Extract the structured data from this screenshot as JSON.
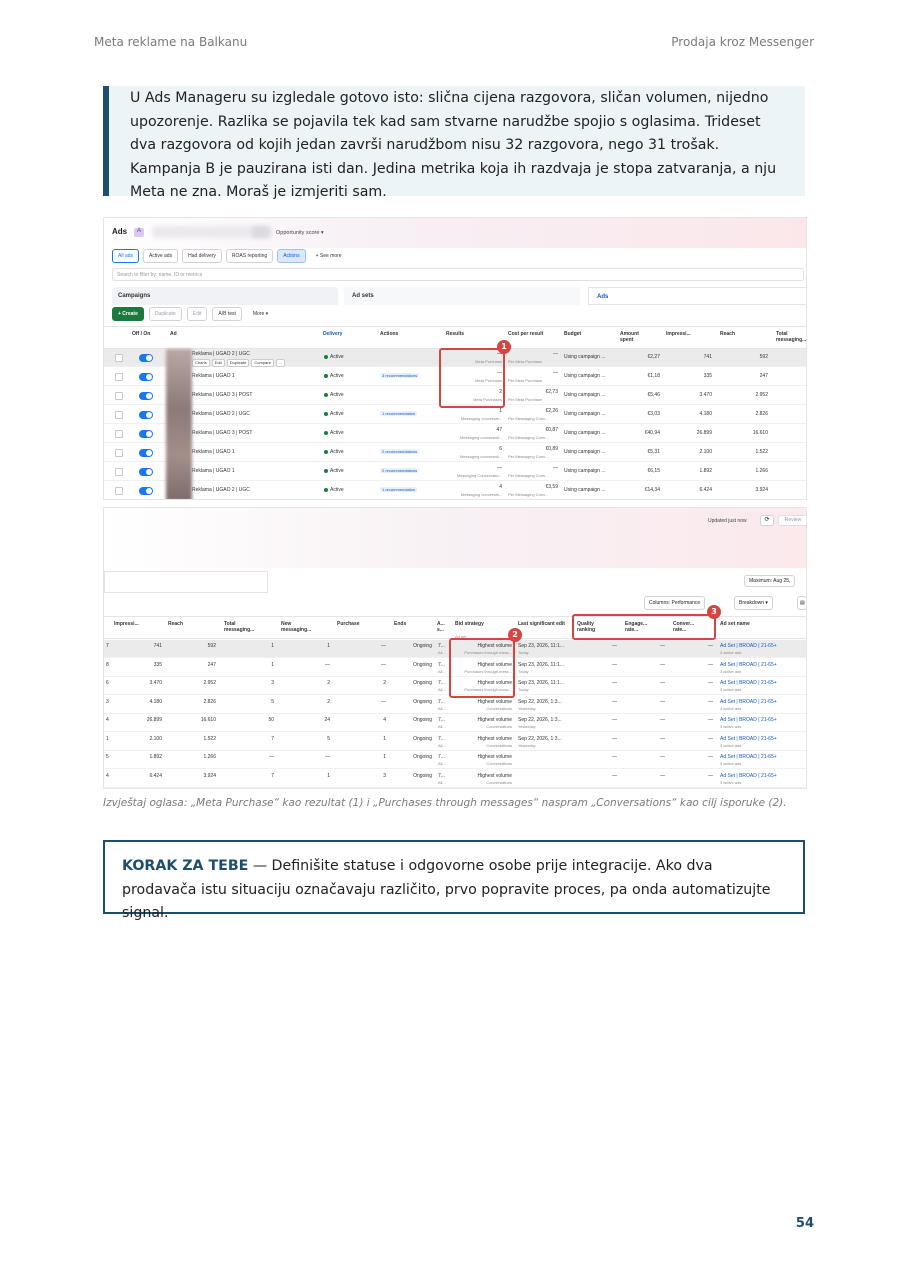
{
  "header": {
    "left": "Meta reklame na Balkanu",
    "right": "Prodaja kroz Messenger"
  },
  "quote": "U Ads Manageru su izgledale gotovo isto: slična cijena razgovora, sličan volumen, nijedno upozorenje. Razlika se pojavila tek kad sam stvarne narudžbe spojio s oglasima. Trideset dva razgovora od kojih jedan završi narudžbom nisu 32 razgovora, nego 31 trošak. Kampanja B je pauzirana isti dan. Jedina metrika koja ih razdvaja je stopa zatvaranja, a nju Meta ne zna. Moraš je izmjeriti sam.",
  "screenshot1": {
    "title": "Ads",
    "title_chip": "A",
    "opportunity": "Opportunity score ▾",
    "filters": [
      "All ads",
      "Active ads",
      "Had delivery",
      "ROAS reporting",
      "Actions",
      "+ See more"
    ],
    "search_placeholder": "Search to filter by: name, ID or metrics",
    "tabs": [
      "Campaigns",
      "Ad sets",
      "Ads"
    ],
    "actions": [
      "+ Create",
      "Duplicate",
      "Edit",
      "A/B test",
      "More ▾"
    ],
    "columns": [
      "Off / On",
      "Ad",
      "Delivery",
      "Actions",
      "Results",
      "Cost per result",
      "Budget",
      "Amount spent",
      "Impressi...",
      "Reach",
      "Total messaging..."
    ],
    "hover_actions": [
      "Charts",
      "Edit",
      "Duplicate",
      "Compare",
      "..."
    ],
    "rows": [
      {
        "name": "Reklama | UGAO 2 | UGC",
        "delivery": "Active",
        "actions": "",
        "result": "—",
        "result_sub": "Meta Purchase",
        "cpr": "—",
        "cpr_sub": "Per Meta Purchase",
        "budget": "Using campaign ...",
        "spent": "€2,27",
        "impr": "741",
        "reach": "592"
      },
      {
        "name": "Reklama | UGAO 1",
        "delivery": "Active",
        "actions": "3 recommendations",
        "result": "—",
        "result_sub": "Meta Purchase",
        "cpr": "—",
        "cpr_sub": "Per Meta Purchase",
        "budget": "Using campaign ...",
        "spent": "€1,18",
        "impr": "335",
        "reach": "247"
      },
      {
        "name": "Reklama | UGAO 3 | POST",
        "delivery": "Active",
        "actions": "",
        "result": "2",
        "result_sub": "Meta Purchases",
        "cpr": "€2,73",
        "cpr_sub": "Per Meta Purchase",
        "budget": "Using campaign ...",
        "spent": "€5,46",
        "impr": "3.470",
        "reach": "2.952"
      },
      {
        "name": "Reklama | UGAO 2 | UGC",
        "delivery": "Active",
        "actions": "1 recommendation",
        "result": "1",
        "result_sub": "Messaging conversat...",
        "cpr": "€2,26",
        "cpr_sub": "Per Messaging Conv...",
        "budget": "Using campaign ...",
        "spent": "€3,03",
        "impr": "4.180",
        "reach": "2.826"
      },
      {
        "name": "Reklama | UGAO 3 | POST",
        "delivery": "Active",
        "actions": "",
        "result": "47",
        "result_sub": "Messaging conversati...",
        "cpr": "€0,87",
        "cpr_sub": "Per Messaging Conv...",
        "budget": "Using campaign ...",
        "spent": "€40,94",
        "impr": "26.899",
        "reach": "16.610"
      },
      {
        "name": "Reklama | UGAO 1",
        "delivery": "Active",
        "actions": "2 recommendations",
        "result": "6",
        "result_sub": "Messaging conversati...",
        "cpr": "€0,89",
        "cpr_sub": "Per Messaging Conv...",
        "budget": "Using campaign ...",
        "spent": "€5,31",
        "impr": "2.100",
        "reach": "1.522"
      },
      {
        "name": "Reklama | UGAO 1",
        "delivery": "Active",
        "actions": "2 recommendations",
        "result": "—",
        "result_sub": "Messaging Conversatio...",
        "cpr": "—",
        "cpr_sub": "Per Messaging Conv...",
        "budget": "Using campaign ...",
        "spent": "€6,15",
        "impr": "1.892",
        "reach": "1.266"
      },
      {
        "name": "Reklama | UGAO 2 | UGC",
        "delivery": "Active",
        "actions": "1 recommendation",
        "result": "4",
        "result_sub": "Messaging conversat...",
        "cpr": "€3,59",
        "cpr_sub": "Per Messaging Conv...",
        "budget": "Using campaign ...",
        "spent": "€14,34",
        "impr": "6.424",
        "reach": "3.924"
      }
    ]
  },
  "screenshot2": {
    "updated": "Updated just now",
    "review": "Review",
    "max_chip": "Maximum: Aug 25,",
    "columns_chip": "Columns: Performance",
    "breakdown_chip": "Breakdown ▾",
    "columns": [
      "Impressi...",
      "Reach",
      "Total messaging...",
      "New messaging...",
      "Purchase",
      "Ends",
      "A... s...",
      "Bid strategy",
      "Last significant edit",
      "Quality ranking",
      "Engage... rate...",
      "Conver... rate...",
      "Ad set name"
    ],
    "col_subs": {
      "bid": "Ad set",
      "quality": "Ad relevance...",
      "engage": "Ad relevance...",
      "conver": "Ad relevance..."
    },
    "rows": [
      {
        "lead": "7",
        "impr": "741",
        "reach": "592",
        "total": "1",
        "new": "1",
        "purchase": "—",
        "ends": "Ongoing",
        "as": "7...",
        "as_sub": "All...",
        "bid": "Highest volume",
        "bid_sub": "Purchases through mess...",
        "edit": "Sep 23, 2026, 11:1...",
        "edit_sub": "Today",
        "q": "—",
        "e": "—",
        "c": "—",
        "adset": "Ad Set | BROAD | 21-65+",
        "adset_sub": "3 active ads"
      },
      {
        "lead": "8",
        "impr": "335",
        "reach": "247",
        "total": "1",
        "new": "—",
        "purchase": "—",
        "ends": "Ongoing",
        "as": "7...",
        "as_sub": "All...",
        "bid": "Highest volume",
        "bid_sub": "Purchases through mess...",
        "edit": "Sep 23, 2026, 11:1...",
        "edit_sub": "Today",
        "q": "—",
        "e": "—",
        "c": "—",
        "adset": "Ad Set | BROAD | 21-65+",
        "adset_sub": "3 active ads"
      },
      {
        "lead": "6",
        "impr": "3.470",
        "reach": "2.952",
        "total": "3",
        "new": "2",
        "purchase": "2",
        "ends": "Ongoing",
        "as": "7...",
        "as_sub": "All...",
        "bid": "Highest volume",
        "bid_sub": "Purchases through mess...",
        "edit": "Sep 23, 2026, 11:1...",
        "edit_sub": "Today",
        "q": "—",
        "e": "—",
        "c": "—",
        "adset": "Ad Set | BROAD | 21-65+",
        "adset_sub": "3 active ads"
      },
      {
        "lead": "3",
        "impr": "4.180",
        "reach": "2.826",
        "total": "5",
        "new": "2",
        "purchase": "—",
        "ends": "Ongoing",
        "as": "7...",
        "as_sub": "All...",
        "bid": "Highest volume",
        "bid_sub": "Conversations",
        "edit": "Sep 22, 2026, 1:3...",
        "edit_sub": "Yesterday",
        "q": "—",
        "e": "—",
        "c": "—",
        "adset": "Ad Set | BROAD | 21-65+",
        "adset_sub": "3 active ads"
      },
      {
        "lead": "4",
        "impr": "26.899",
        "reach": "16.610",
        "total": "50",
        "new": "24",
        "purchase": "4",
        "ends": "Ongoing",
        "as": "7...",
        "as_sub": "All...",
        "bid": "Highest volume",
        "bid_sub": "Conversations",
        "edit": "Sep 22, 2026, 1:3...",
        "edit_sub": "Yesterday",
        "q": "—",
        "e": "—",
        "c": "—",
        "adset": "Ad Set | BROAD | 21-65+",
        "adset_sub": "3 active ads"
      },
      {
        "lead": "1",
        "impr": "2.100",
        "reach": "1.522",
        "total": "7",
        "new": "5",
        "purchase": "1",
        "ends": "Ongoing",
        "as": "7...",
        "as_sub": "All...",
        "bid": "Highest volume",
        "bid_sub": "Conversations",
        "edit": "Sep 22, 2026, 1:3...",
        "edit_sub": "Yesterday",
        "q": "—",
        "e": "—",
        "c": "—",
        "adset": "Ad Set | BROAD | 21-65+",
        "adset_sub": "3 active ads"
      },
      {
        "lead": "5",
        "impr": "1.892",
        "reach": "1.266",
        "total": "—",
        "new": "—",
        "purchase": "1",
        "ends": "Ongoing",
        "as": "7...",
        "as_sub": "All...",
        "bid": "Highest volume",
        "bid_sub": "Conversations",
        "edit": "",
        "edit_sub": "",
        "q": "—",
        "e": "—",
        "c": "—",
        "adset": "Ad Set | BROAD | 21-65+",
        "adset_sub": "3 active ads"
      },
      {
        "lead": "4",
        "impr": "6.424",
        "reach": "3.924",
        "total": "7",
        "new": "1",
        "purchase": "3",
        "ends": "Ongoing",
        "as": "7...",
        "as_sub": "All...",
        "bid": "Highest volume",
        "bid_sub": "Conversations",
        "edit": "",
        "edit_sub": "",
        "q": "—",
        "e": "—",
        "c": "—",
        "adset": "Ad Set | BROAD | 21-65+",
        "adset_sub": "3 active ads"
      }
    ]
  },
  "markers": [
    "1",
    "2",
    "3"
  ],
  "marker_color": "#d64541",
  "caption": "Izvještaj oglasa: „Meta Purchase“ kao rezultat (1) i „Purchases through messages“ naspram „Conversations“ kao cilj isporuke (2).",
  "action_box": {
    "title": "KORAK ZA TEBE",
    "body": " — Definišite statuse i odgovorne osobe prije integracije. Ako dva prodavača istu situaciju označavaju različito, prvo popravite proces, pa onda automatizujte signal."
  },
  "page_number": "54",
  "accent_color": "#1d4e6e"
}
